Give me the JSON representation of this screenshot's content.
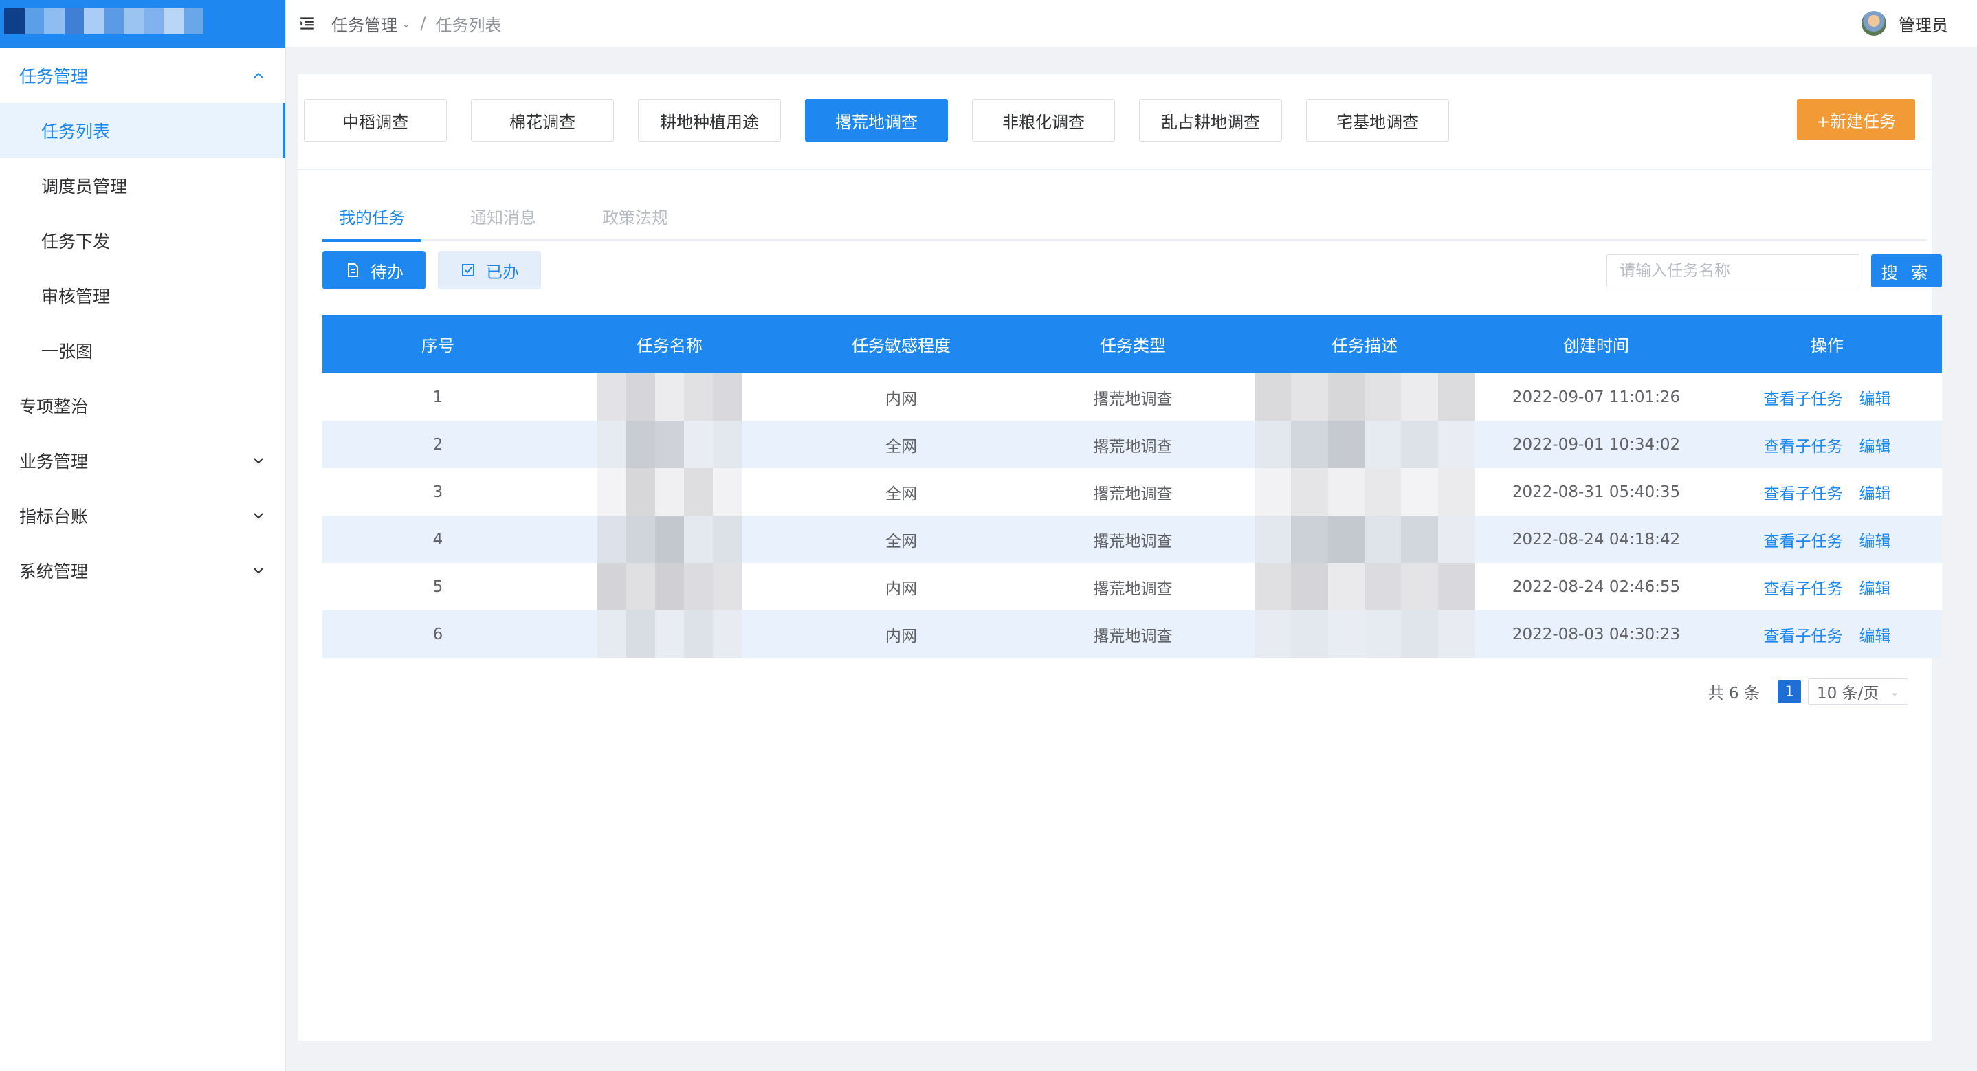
{
  "sidebar": {
    "items": [
      {
        "label": "任务管理",
        "state": "open"
      },
      {
        "label": "任务列表",
        "state": "active"
      },
      {
        "label": "调度员管理"
      },
      {
        "label": "任务下发"
      },
      {
        "label": "审核管理"
      },
      {
        "label": "一张图"
      },
      {
        "label": "专项整治"
      },
      {
        "label": "业务管理"
      },
      {
        "label": "指标台账"
      },
      {
        "label": "系统管理"
      }
    ]
  },
  "header": {
    "breadcrumb": [
      "任务管理",
      "任务列表"
    ],
    "user": "管理员"
  },
  "task_types": [
    "中稻调查",
    "棉花调查",
    "耕地种植用途",
    "撂荒地调查",
    "非粮化调查",
    "乱占耕地调查",
    "宅基地调查"
  ],
  "active_task_type": "撂荒地调查",
  "new_task_label": "+新建任务",
  "tabs": [
    "我的任务",
    "通知消息",
    "政策法规"
  ],
  "state_buttons": {
    "todo": "待办",
    "done": "已办"
  },
  "search": {
    "placeholder": "请输入任务名称",
    "value": "",
    "button": "搜 索"
  },
  "table": {
    "headers": [
      "序号",
      "任务名称",
      "任务敏感程度",
      "任务类型",
      "任务描述",
      "创建时间",
      "操作"
    ],
    "rows": [
      {
        "index": "1",
        "sensitivity": "内网",
        "type": "撂荒地调查",
        "created": "2022-09-07 11:01:26"
      },
      {
        "index": "2",
        "sensitivity": "全网",
        "type": "撂荒地调查",
        "created": "2022-09-01 10:34:02"
      },
      {
        "index": "3",
        "sensitivity": "全网",
        "type": "撂荒地调查",
        "created": "2022-08-31 05:40:35"
      },
      {
        "index": "4",
        "sensitivity": "全网",
        "type": "撂荒地调查",
        "created": "2022-08-24 04:18:42"
      },
      {
        "index": "5",
        "sensitivity": "内网",
        "type": "撂荒地调查",
        "created": "2022-08-24 02:46:55"
      },
      {
        "index": "6",
        "sensitivity": "内网",
        "type": "撂荒地调查",
        "created": "2022-08-03 04:30:23"
      }
    ],
    "actions": {
      "view": "查看子任务",
      "edit": "编辑"
    }
  },
  "pagination": {
    "total": "共 6 条",
    "current": "1",
    "page_size": "10 条/页"
  },
  "colors": {
    "primary": "#1e88f0",
    "accent": "#f29a36"
  }
}
